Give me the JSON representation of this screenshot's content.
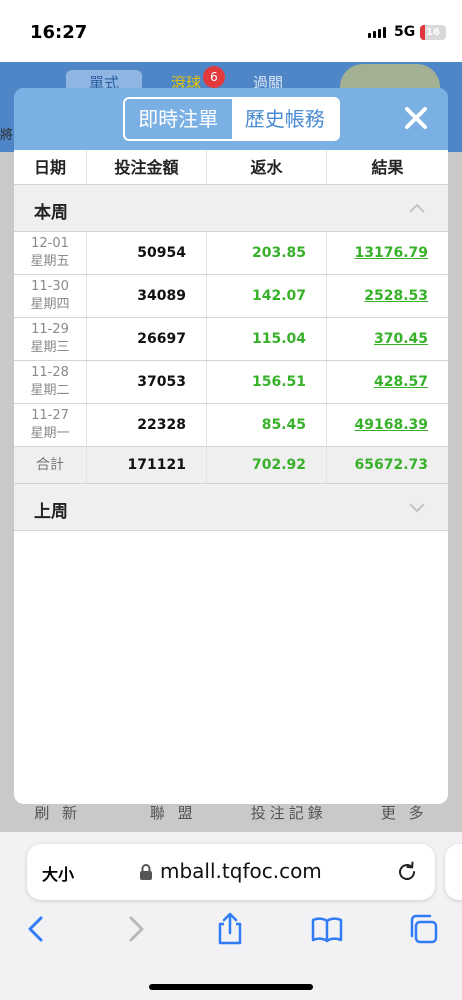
{
  "status_bar": {
    "time": "16:27",
    "network": "5G",
    "battery": "16"
  },
  "background": {
    "tabs": [
      "單式",
      "滾球",
      "過關"
    ],
    "badge": "6",
    "left_text": "將",
    "bottom_nav": [
      "刷 新",
      "聯 盟",
      "投注記錄",
      "更 多"
    ]
  },
  "modal": {
    "tabs": {
      "live": "即時注單",
      "history": "歷史帳務"
    },
    "active_tab": "history",
    "columns": [
      "日期",
      "投注金額",
      "返水",
      "結果"
    ],
    "this_week_label": "本周",
    "last_week_label": "上周",
    "rows": [
      {
        "date": "12-01",
        "weekday": "星期五",
        "stake": "50954",
        "rebate": "203.85",
        "result": "13176.79"
      },
      {
        "date": "11-30",
        "weekday": "星期四",
        "stake": "34089",
        "rebate": "142.07",
        "result": "2528.53"
      },
      {
        "date": "11-29",
        "weekday": "星期三",
        "stake": "26697",
        "rebate": "115.04",
        "result": "370.45"
      },
      {
        "date": "11-28",
        "weekday": "星期二",
        "stake": "37053",
        "rebate": "156.51",
        "result": "428.57"
      },
      {
        "date": "11-27",
        "weekday": "星期一",
        "stake": "22328",
        "rebate": "85.45",
        "result": "49168.39"
      }
    ],
    "total": {
      "label": "合計",
      "stake": "171121",
      "rebate": "702.92",
      "result": "65672.73"
    },
    "colors": {
      "header": "#7ab0e4",
      "positive": "#38b12a"
    }
  },
  "browser": {
    "text_size": "大小",
    "url": "mball.tqfoc.com"
  }
}
